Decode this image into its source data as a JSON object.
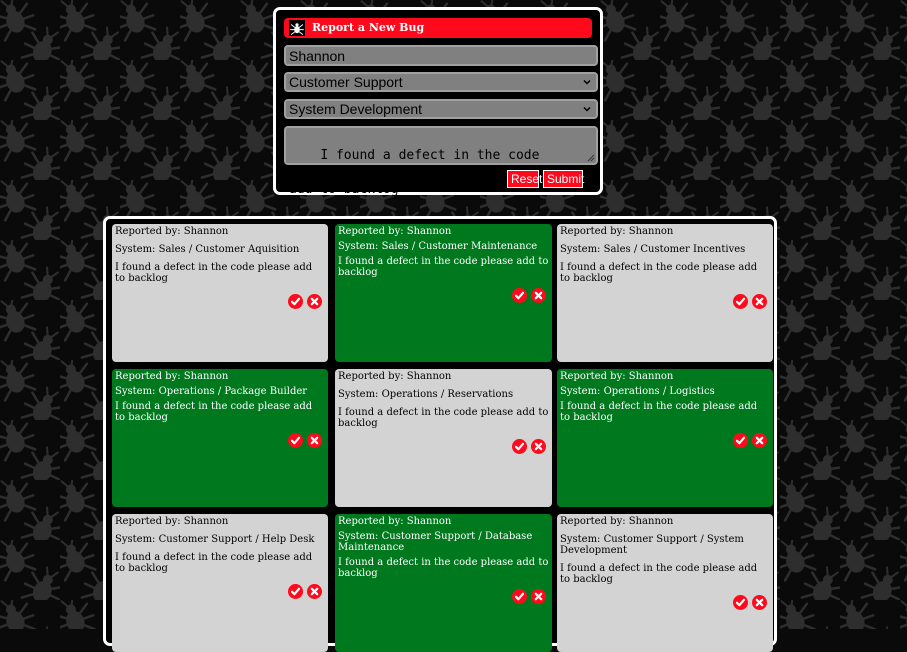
{
  "form": {
    "header": "Report a New Bug",
    "name_value": "Shannon",
    "department_value": "Customer Support",
    "system_value": "System Development",
    "description_value": "I found a defect in the code please\nadd to backlog",
    "reset_label": "Reset",
    "submit_label": "Submit",
    "colors": {
      "header_bg": "#ff0a1c",
      "field_bg": "#808080"
    }
  },
  "bugs": [
    {
      "reporter": "Reported by: Shannon",
      "system": "System: Sales / Customer Aquisition",
      "description": "I found a defect in the code please add to backlog",
      "status": "grey"
    },
    {
      "reporter": "Reported by: Shannon",
      "system": "System: Sales / Customer Maintenance",
      "description": "I found a defect in the code please add to backlog",
      "status": "green"
    },
    {
      "reporter": "Reported by: Shannon",
      "system": "System: Sales / Customer Incentives",
      "description": "I found a defect in the code please add to backlog",
      "status": "grey"
    },
    {
      "reporter": "Reported by: Shannon",
      "system": "System: Operations / Package Builder",
      "description": "I found a defect in the code please add to backlog",
      "status": "green"
    },
    {
      "reporter": "Reported by: Shannon",
      "system": "System: Operations / Reservations",
      "description": "I found a defect in the code please add to backlog",
      "status": "grey"
    },
    {
      "reporter": "Reported by: Shannon",
      "system": "System: Operations / Logistics",
      "description": "I found a defect in the code please add to backlog",
      "status": "green"
    },
    {
      "reporter": "Reported by: Shannon",
      "system": "System: Customer Support / Help Desk",
      "description": "I found a defect in the code please add to backlog",
      "status": "grey"
    },
    {
      "reporter": "Reported by: Shannon",
      "system": "System: Customer Support / Database Maintenance",
      "description": "I found a defect in the code please add to backlog",
      "status": "green"
    },
    {
      "reporter": "Reported by: Shannon",
      "system": "System: Customer Support / System Development",
      "description": "I found a defect in the code please add to backlog",
      "status": "grey"
    }
  ],
  "icons": {
    "header": "bug-icon",
    "resolve": "check-icon",
    "delete": "close-icon",
    "background": "bug-pattern"
  },
  "colors": {
    "accent_red": "#ff0a1c",
    "resolved_green": "#00791e",
    "open_grey": "#d3d3d3"
  }
}
